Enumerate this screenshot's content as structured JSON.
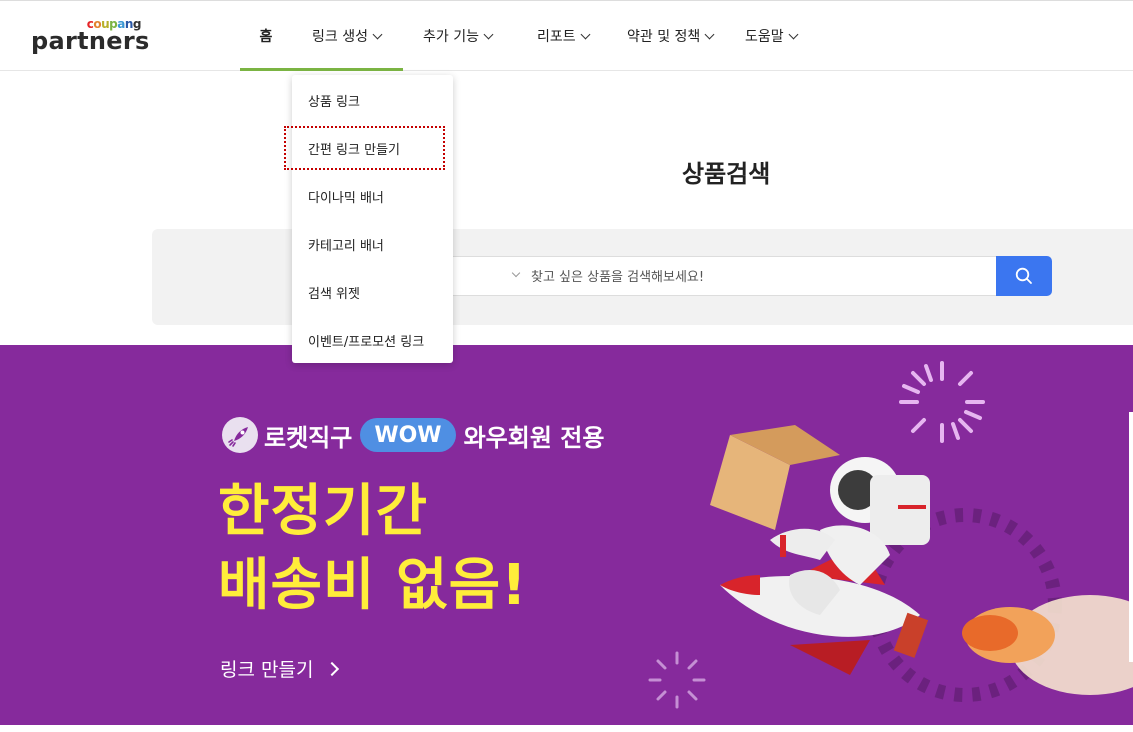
{
  "header": {
    "logo_sub": [
      "c",
      "o",
      "u",
      "p",
      "a",
      "n",
      "g"
    ],
    "logo_main": "partners",
    "nav": [
      {
        "label": "홈",
        "has_dropdown": false
      },
      {
        "label": "링크 생성",
        "has_dropdown": true
      },
      {
        "label": "추가 기능",
        "has_dropdown": true
      },
      {
        "label": "리포트",
        "has_dropdown": true
      },
      {
        "label": "약관 및 정책",
        "has_dropdown": true
      },
      {
        "label": "도움말",
        "has_dropdown": true
      }
    ],
    "accent_color": "#7bb443"
  },
  "dropdown": {
    "items": [
      "상품 링크",
      "간편 링크 만들기",
      "다이나믹 배너",
      "카테고리 배너",
      "검색 위젯",
      "이벤트/프로모션 링크"
    ],
    "highlighted_index": 1
  },
  "search": {
    "title": "상품검색",
    "placeholder": "찾고 싶은 상품을 검색해보세요!",
    "button_color": "#3b76f0",
    "button_icon": "search-icon"
  },
  "banner": {
    "badge_text": "로켓직구",
    "wow_label": "WOW",
    "member_text": "와우회원 전용",
    "headline_line1": "한정기간",
    "headline_line2": "배송비 없음!",
    "link_label": "링크 만들기",
    "bg_color": "#862a9c",
    "headline_color": "#ffed3a"
  }
}
